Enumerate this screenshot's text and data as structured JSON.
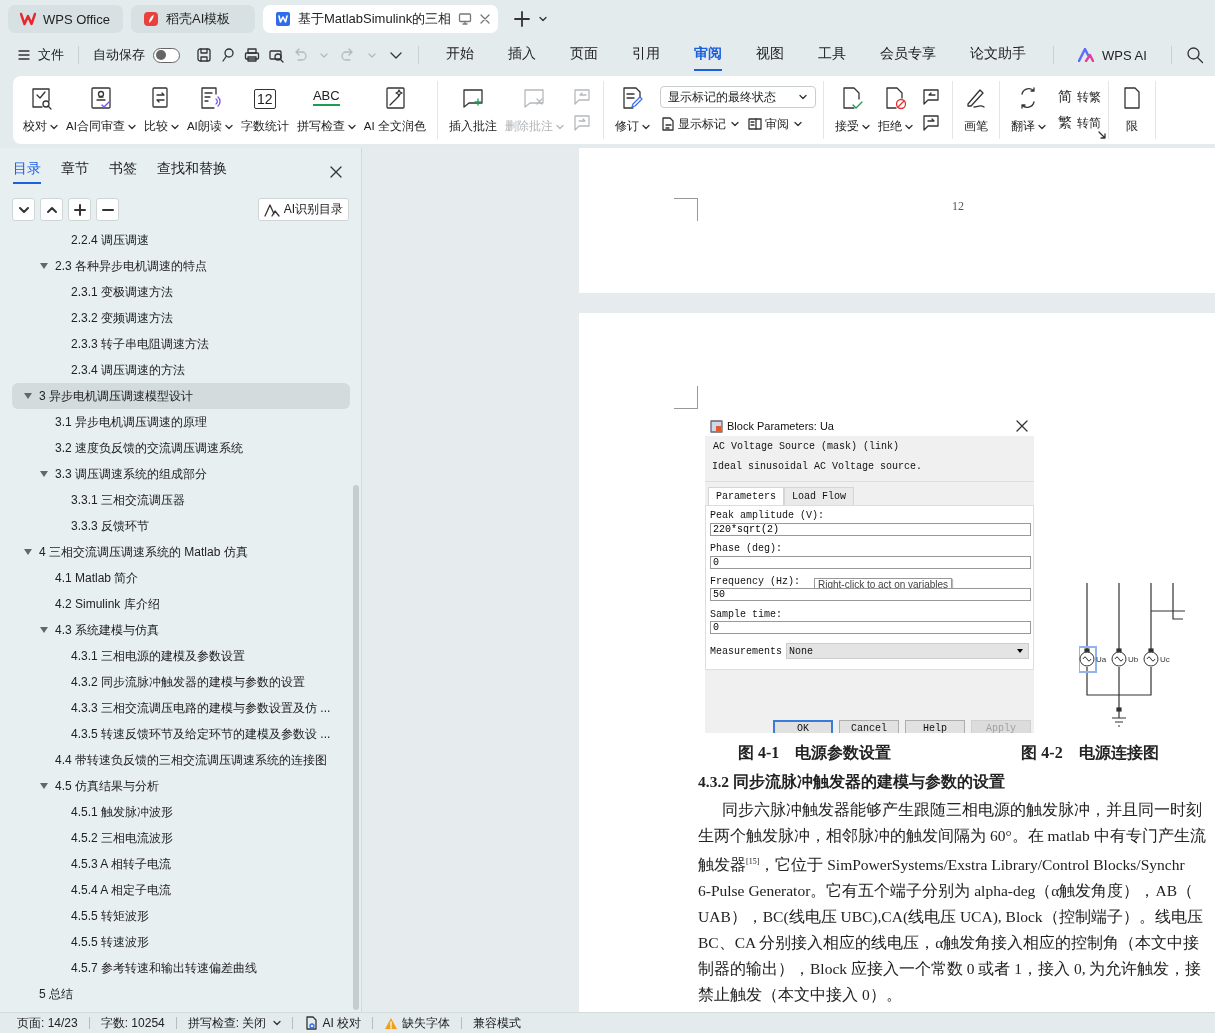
{
  "tabs": [
    {
      "label": "WPS Office",
      "selected": false
    },
    {
      "label": "稻壳AI模板",
      "selected": false
    },
    {
      "label": "基于MatlabSimulink的三相",
      "selected": true
    }
  ],
  "menu": {
    "file": "文件",
    "autosave": {
      "label": "自动保存",
      "on": false
    },
    "tabs": [
      {
        "label": "开始",
        "selected": false
      },
      {
        "label": "插入",
        "selected": false
      },
      {
        "label": "页面",
        "selected": false
      },
      {
        "label": "引用",
        "selected": false
      },
      {
        "label": "审阅",
        "selected": true
      },
      {
        "label": "视图",
        "selected": false
      },
      {
        "label": "工具",
        "selected": false
      },
      {
        "label": "会员专享",
        "selected": false
      },
      {
        "label": "论文助手",
        "selected": false
      }
    ],
    "ai": "WPS AI"
  },
  "ribbon": {
    "groups": [
      {
        "items": [
          {
            "kind": "big",
            "label": "校对",
            "dropdown": true,
            "disabled": false
          },
          {
            "kind": "big",
            "label": "AI合同审查",
            "dropdown": true,
            "disabled": false
          },
          {
            "kind": "big",
            "label": "比较",
            "dropdown": true,
            "disabled": false
          },
          {
            "kind": "big",
            "label": "AI朗读",
            "dropdown": true,
            "disabled": false
          },
          {
            "kind": "big",
            "label": "字数统计",
            "glyph": "12",
            "dropdown": false,
            "disabled": false
          },
          {
            "kind": "big",
            "label": "拼写检查",
            "glyph": "ABC",
            "dropdown": true,
            "disabled": false
          },
          {
            "kind": "big",
            "label": "AI 全文润色",
            "dropdown": false,
            "disabled": false
          }
        ]
      },
      {
        "items": [
          {
            "kind": "big",
            "label": "插入批注",
            "dropdown": false,
            "disabled": false
          },
          {
            "kind": "big",
            "label": "删除批注",
            "dropdown": true,
            "disabled": true
          },
          {
            "kind": "icons",
            "disabled": true
          }
        ]
      },
      {
        "items": [
          {
            "kind": "big",
            "label": "修订",
            "dropdown": true,
            "disabled": false
          },
          {
            "kind": "panel",
            "select": "显示标记的最终状态",
            "buttons": [
              {
                "label": "显示标记",
                "dropdown": true
              },
              {
                "label": "审阅",
                "dropdown": true
              }
            ]
          }
        ]
      },
      {
        "items": [
          {
            "kind": "big",
            "label": "接受",
            "dropdown": true,
            "disabled": false
          },
          {
            "kind": "big",
            "label": "拒绝",
            "dropdown": true,
            "disabled": false
          },
          {
            "kind": "icons",
            "disabled": false
          }
        ]
      },
      {
        "items": [
          {
            "kind": "big",
            "label": "画笔",
            "dropdown": false,
            "disabled": false
          }
        ]
      },
      {
        "items": [
          {
            "kind": "big",
            "label": "翻译",
            "dropdown": true,
            "disabled": false
          },
          {
            "kind": "stack",
            "buttons": [
              {
                "glyph": "简",
                "label": "转繁"
              },
              {
                "glyph": "繁",
                "label": "转简"
              }
            ]
          }
        ]
      },
      {
        "items": [
          {
            "kind": "big",
            "label": "限",
            "dropdown": false,
            "disabled": false
          }
        ]
      }
    ]
  },
  "sidebar": {
    "tabs": [
      {
        "label": "目录",
        "selected": true
      },
      {
        "label": "章节",
        "selected": false
      },
      {
        "label": "书签",
        "selected": false
      },
      {
        "label": "查找和替换",
        "selected": false
      }
    ],
    "ai_button": "AI识别目录",
    "toc": [
      {
        "children": [
          {
            "children": [
              {
                "label": "2.2.4 调压调速",
                "selected": false
              }
            ]
          },
          {
            "label": "2.3  各种异步电机调速的特点",
            "selected": false,
            "expanded": true,
            "children": [
              {
                "label": "2.3.1  变极调速方法",
                "selected": false
              },
              {
                "label": "2.3.2  变频调速方法",
                "selected": false
              },
              {
                "label": "2.3.3  转子串电阻调速方法",
                "selected": false
              },
              {
                "label": "2.3.4  调压调速的方法",
                "selected": false
              }
            ]
          }
        ]
      },
      {
        "label": "3  异步电机调压调速模型设计",
        "selected": true,
        "expanded": true,
        "children": [
          {
            "label": "3.1  异步电机调压调速的原理",
            "selected": false
          },
          {
            "label": "3.2  速度负反馈的交流调压调速系统",
            "selected": false
          },
          {
            "label": "3.3  调压调速系统的组成部分",
            "selected": false,
            "expanded": true,
            "children": [
              {
                "label": "3.3.1  三相交流调压器",
                "selected": false
              },
              {
                "label": "3.3.3  反馈环节",
                "selected": false
              }
            ]
          }
        ]
      },
      {
        "label": "4  三相交流调压调速系统的 Matlab 仿真",
        "selected": false,
        "expanded": true,
        "children": [
          {
            "label": "4.1 Matlab 简介",
            "selected": false
          },
          {
            "label": "4.2 Simulink 库介绍",
            "selected": false
          },
          {
            "label": "4.3  系统建模与仿真",
            "selected": false,
            "expanded": true,
            "children": [
              {
                "label": "4.3.1  三相电源的建模及参数设置",
                "selected": false
              },
              {
                "label": "4.3.2  同步流脉冲触发器的建模与参数的设置",
                "selected": false
              },
              {
                "label": "4.3.3  三相交流调压电路的建模与参数设置及仿 ...",
                "selected": false
              },
              {
                "label": "4.3.5  转速反馈环节及给定环节的建模及参数设 ...",
                "selected": false
              }
            ]
          },
          {
            "label": "4.4  带转速负反馈的三相交流调压调速系统的连接图",
            "selected": false
          },
          {
            "label": "4.5  仿真结果与分析",
            "selected": false,
            "expanded": true,
            "children": [
              {
                "label": "4.5.1 触发脉冲波形",
                "selected": false
              },
              {
                "label": "4.5.2  三相电流波形",
                "selected": false
              },
              {
                "label": "4.5.3 A 相转子电流",
                "selected": false
              },
              {
                "label": "4.5.4 A 相定子电流",
                "selected": false
              },
              {
                "label": "4.5.5  转矩波形",
                "selected": false
              },
              {
                "label": "4.5.5  转速波形",
                "selected": false
              },
              {
                "label": "4.5.7  参考转速和输出转速偏差曲线",
                "selected": false
              }
            ]
          }
        ]
      },
      {
        "label": "5  总结",
        "selected": false
      }
    ]
  },
  "document": {
    "page_number": "12",
    "dialog": {
      "title": "Block Parameters: Ua",
      "mask": "AC Voltage Source (mask) (link)",
      "description": "Ideal sinusoidal AC Voltage source.",
      "tabs": [
        {
          "label": "Parameters",
          "selected": true
        },
        {
          "label": "Load Flow",
          "selected": false
        }
      ],
      "fields": [
        {
          "label": "Peak amplitude (V):",
          "value": "220*sqrt(2)"
        },
        {
          "label": "Phase (deg):",
          "value": "0"
        },
        {
          "label": "Frequency (Hz):",
          "value": "50",
          "tooltip": "Right-click to act on variables"
        },
        {
          "label": "Sample time:",
          "value": "0"
        }
      ],
      "measurements": {
        "label": "Measurements",
        "value": "None"
      },
      "buttons": [
        {
          "label": "OK",
          "disabled": false
        },
        {
          "label": "Cancel",
          "disabled": false
        },
        {
          "label": "Help",
          "disabled": false
        },
        {
          "label": "Apply",
          "disabled": true
        }
      ]
    },
    "circuit": {
      "sources": [
        {
          "label": "Ua",
          "selected": true
        },
        {
          "label": "Ub",
          "selected": false
        },
        {
          "label": "Uc",
          "selected": false
        }
      ]
    },
    "captions": [
      "图 4-1　电源参数设置",
      "图 4-2　电源连接图"
    ],
    "heading": "4.3.2  同步流脉冲触发器的建模与参数的设置",
    "lines": [
      "同步六脉冲触发器能够产生跟随三相电源的触发脉冲，并且同一时刻",
      "生两个触发脉冲，相邻脉冲的触发间隔为 60°。在 matlab 中有专门产生流",
      "触发器$^{[15]}$，它位于 SimPowerSystems/Exstra Library/Control Blocks/Synchr",
      "6-Pulse Generator。它有五个端子分别为 alpha-deg（α触发角度），AB（",
      "UAB），BC(线电压 UBC),CA(线电压 UCA), Block（控制端子）。线电压",
      "BC、CA 分别接入相应的线电压，α触发角接入相应的控制角（本文中接",
      "制器的输出），Block 应接入一个常数 0 或者 1，接入 0, 为允许触发，接",
      "禁止触发（本文中接入 0）。"
    ]
  },
  "status_bar": [
    {
      "kind": "text",
      "label": "页面: 14/23"
    },
    {
      "kind": "text",
      "label": "字数: 10254"
    },
    {
      "kind": "dropdown",
      "label": "拼写检查: 关闭"
    },
    {
      "kind": "ai-check",
      "label": "AI 校对"
    },
    {
      "kind": "warning",
      "label": "缺失字体"
    },
    {
      "kind": "text",
      "label": "兼容模式"
    }
  ]
}
